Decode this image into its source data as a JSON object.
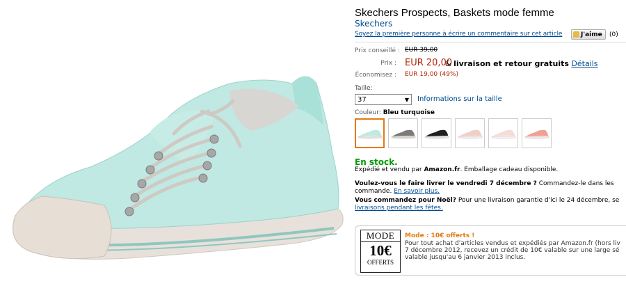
{
  "product": {
    "title": "Skechers Prospects, Baskets mode femme",
    "brand": "Skechers",
    "review_link": "Soyez la première personne à écrire un commentaire sur cet article",
    "like_label": "J'aime",
    "like_count": "(0)"
  },
  "pricing": {
    "list_label": "Prix conseillé :",
    "list_price": "EUR 39,00",
    "price_label": "Prix :",
    "price": "EUR 20,00",
    "shipping_prefix": "&",
    "shipping_bold": "livraison et retour gratuits",
    "details_link": "Détails",
    "savings_label": "Économisez :",
    "savings": "EUR 19,00 (49%)"
  },
  "size": {
    "label": "Taille:",
    "selected": "37",
    "info_link": "Informations sur la taille"
  },
  "color": {
    "label": "Couleur:",
    "selected": "Bleu turquoise",
    "swatches": [
      {
        "name": "bleu-turquoise",
        "body": "#bfe9e3",
        "sole": "#e6e0da",
        "selected": true
      },
      {
        "name": "gris",
        "body": "#7d7b76",
        "sole": "#d8d4ce",
        "selected": false
      },
      {
        "name": "noir",
        "body": "#1f1f1f",
        "sole": "#e2e2e2",
        "selected": false
      },
      {
        "name": "rose-pale",
        "body": "#efcfc7",
        "sole": "#f3ece9",
        "selected": false
      },
      {
        "name": "rose-clair",
        "body": "#f6dcd9",
        "sole": "#f5f0ee",
        "selected": false
      },
      {
        "name": "corail",
        "body": "#ef9f94",
        "sole": "#f0e6e2",
        "selected": false
      }
    ]
  },
  "availability": {
    "stock": "En stock.",
    "sold_prefix": "Expédié et vendu par",
    "sold_by": "Amazon.fr",
    "sold_suffix": ". Emballage cadeau disponible.",
    "delivery_bold": "Voulez-vous le faire livrer le vendredi 7 décembre ?",
    "delivery_text": " Commandez-le dans les",
    "delivery_line2": "commande.",
    "delivery_link": "En savoir plus.",
    "christmas_bold": "Vous commandez pour Noël?",
    "christmas_text": " Pour une livraison garantie d'ici le 24 décembre, se",
    "christmas_link": "livraisons pendant les fêtes."
  },
  "promo": {
    "badge_top": "MODE",
    "badge_big": "10€",
    "badge_bottom": "OFFERTS",
    "title": "Mode : 10€ offerts !",
    "line1": "Pour tout achat d'articles vendus et expédiés par Amazon.fr (hors liv",
    "line2": "7 décembre 2012, recevez un crédit de 10€ valable sur une large sé",
    "line3": "valable jusqu'au 6 janvier 2013 inclus."
  },
  "colors": {
    "link": "#004b91",
    "price": "#b12704",
    "stock": "#009900",
    "promo": "#e47911"
  }
}
